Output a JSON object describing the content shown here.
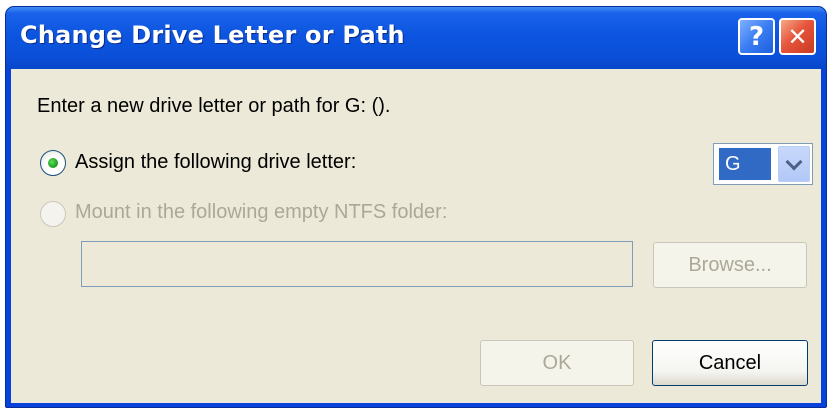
{
  "dialog": {
    "title": "Change Drive Letter or Path",
    "help_label": "?",
    "close_label": "✕"
  },
  "content": {
    "instruction": "Enter a new drive letter or path for G: ().",
    "assign_option": {
      "label": "Assign the following drive letter:",
      "selected": true
    },
    "mount_option": {
      "label": "Mount in the following empty NTFS folder:",
      "selected": false,
      "enabled": false
    },
    "drive_letter": {
      "value": "G"
    },
    "folder_path": {
      "value": ""
    },
    "browse_label": "Browse..."
  },
  "buttons": {
    "ok_label": "OK",
    "cancel_label": "Cancel"
  },
  "colors": {
    "titlebar": "#0a4fd8",
    "client_bg": "#ece9d8",
    "selection": "#316ac5",
    "disabled_text": "#aca899"
  }
}
